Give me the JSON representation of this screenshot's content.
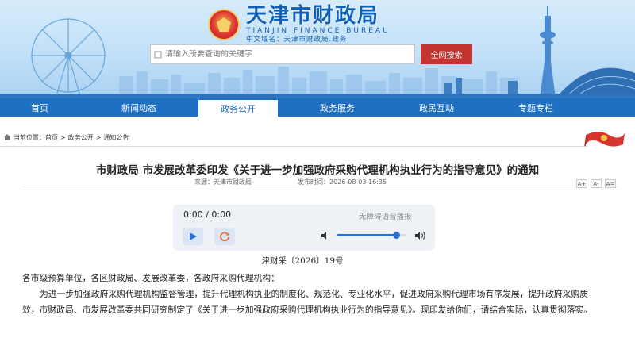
{
  "header": {
    "site_name_cn": "天津市财政局",
    "site_name_en": "TIANJIN FINANCE BUREAU",
    "domain_text": "中文域名：天津市财政局.政务"
  },
  "search": {
    "placeholder": "请输入所要查询的关键字",
    "button_label": "全网搜索"
  },
  "nav": {
    "items": [
      {
        "label": "首页"
      },
      {
        "label": "新闻动态"
      },
      {
        "label": "政务公开"
      },
      {
        "label": "政务服务"
      },
      {
        "label": "政民互动"
      },
      {
        "label": "专题专栏"
      }
    ],
    "active": "政务公开"
  },
  "breadcrumb": {
    "prefix": "当前位置：",
    "items": [
      "首页",
      "政务公开",
      "通知公告"
    ],
    "separator": ">"
  },
  "article": {
    "title": "市财政局 市发展改革委印发《关于进一步加强政府采购代理机构执业行为的指导意见》的通知",
    "source": "来源：天津市财政局",
    "publish_time": "发布时间：2026-08-03 16:35",
    "font_controls": [
      "A+",
      "A-",
      "A="
    ],
    "doc_number": "津财采〔2026〕19号",
    "addressee": "各市级预算单位，各区财政局、发展改革委，各政府采购代理机构：",
    "paragraph_1": "为进一步加强政府采购代理机构监督管理，提升代理机构执业的制度化、规范化、专业化水平，促进政府采购代理市场有序发展，提升政府采购质效，市财政局、市发展改革委共同研究制定了《关于进一步加强政府采购代理机构执业行为的指导意见》。现印发给你们，请结合实际，认真贯彻落实。"
  },
  "player": {
    "time": "0:00 / 0:00",
    "label": "无障碍语音播报",
    "volume": 0.85
  },
  "colors": {
    "nav_blue": "#1f6fc3",
    "search_red": "#c23430",
    "brand_blue": "#0f5fb4"
  }
}
